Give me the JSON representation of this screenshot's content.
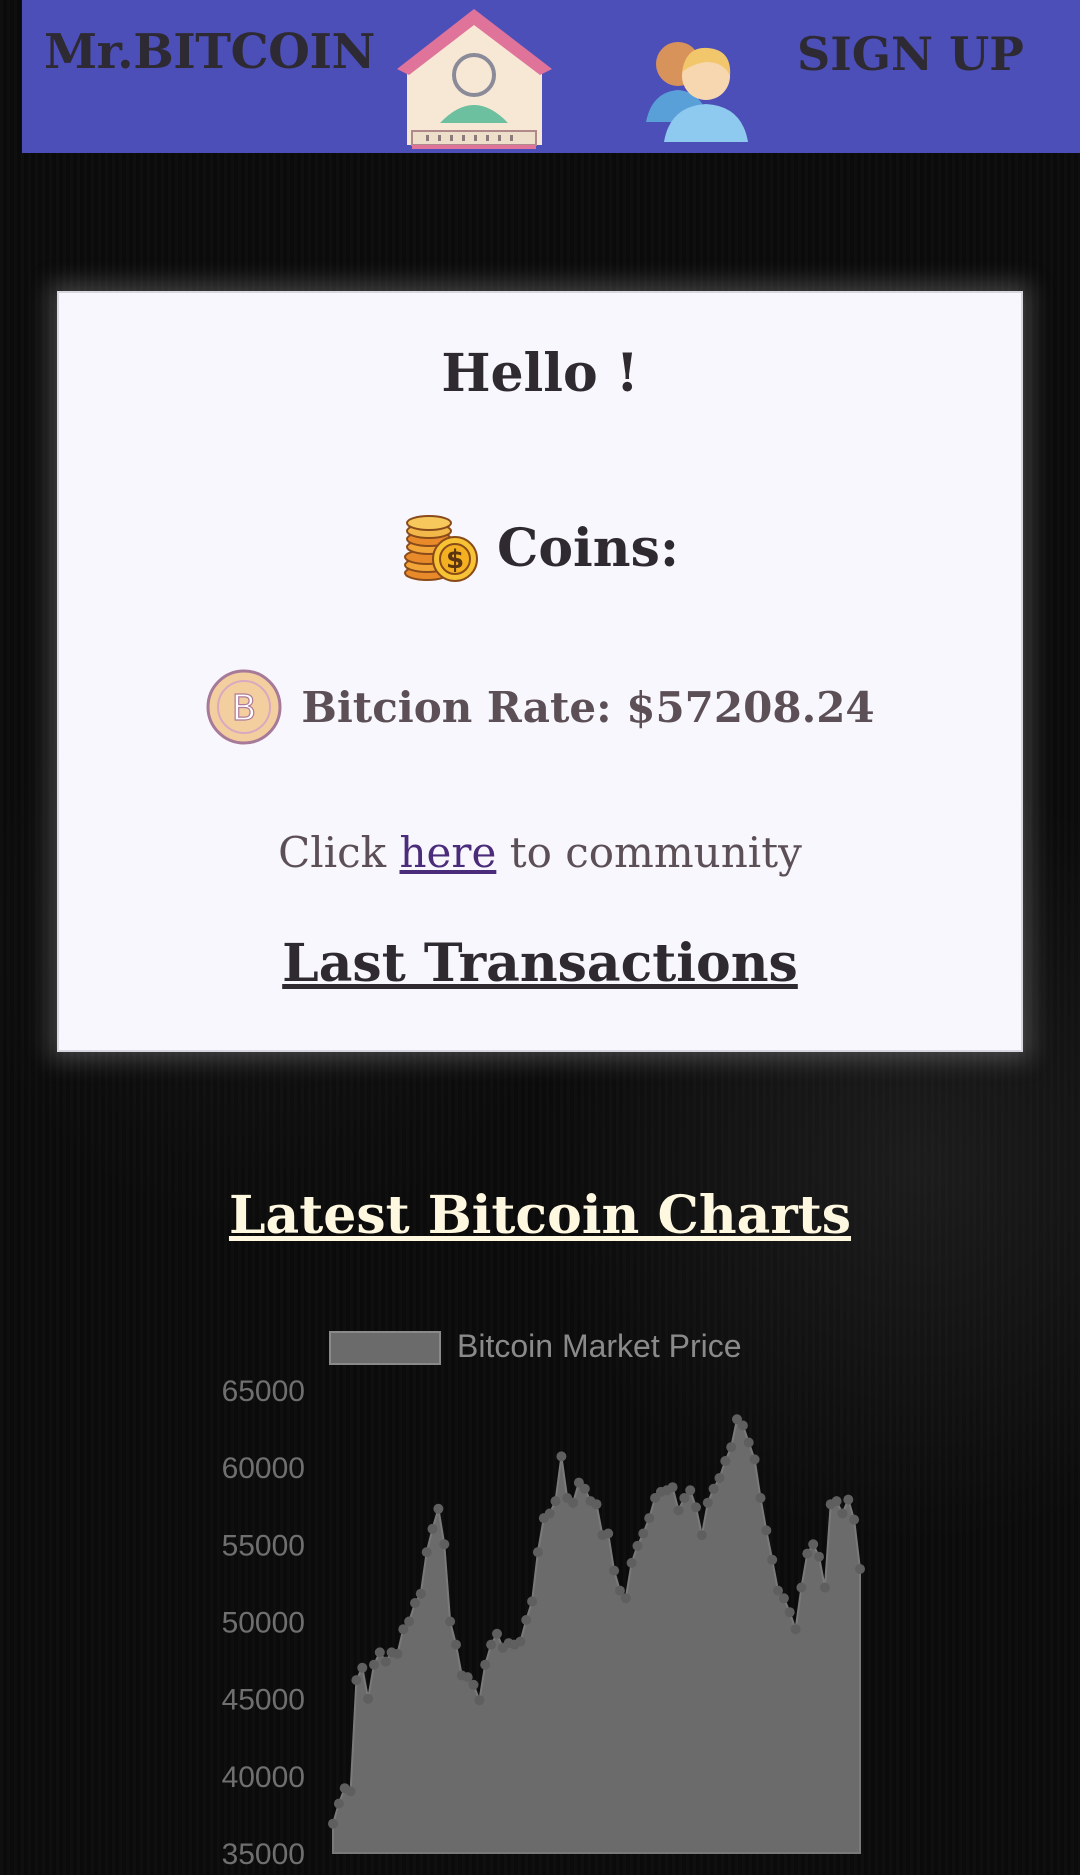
{
  "navbar": {
    "brand": "Mr.BITCOIN",
    "home_icon": "home-user-icon",
    "contacts_icon": "users-icon",
    "signup_label": "SIGN UP",
    "background": "#4d4fb8"
  },
  "card": {
    "greeting": "Hello !",
    "coins_label": "Coins:",
    "coins_icon": "coin-stack-icon",
    "rate_icon": "bitcoin-icon",
    "rate_label": "Bitcion Rate: $57208.24",
    "community": {
      "prefix": "Click",
      "link_text": "here",
      "suffix": "to community"
    },
    "last_transactions_title": "Last Transactions"
  },
  "charts_section": {
    "title": "Latest Bitcoin Charts"
  },
  "chart_data": {
    "type": "area",
    "title": "",
    "xlabel": "",
    "ylabel": "",
    "ylim": [
      35000,
      65000
    ],
    "yticks": [
      "65000",
      "60000",
      "55000",
      "50000",
      "45000",
      "40000",
      "35000"
    ],
    "legend": "top",
    "grid": false,
    "series": [
      {
        "name": "Bitcoin Market Price",
        "color": "#6b6b6b",
        "values": [
          36900,
          38200,
          39200,
          39000,
          46200,
          47000,
          45000,
          47200,
          48000,
          47400,
          48000,
          47900,
          49500,
          50000,
          51200,
          51800,
          54500,
          56000,
          57300,
          55000,
          50000,
          48500,
          46500,
          46400,
          45900,
          44900,
          47200,
          48500,
          49200,
          48300,
          48600,
          48500,
          48700,
          50100,
          51300,
          54500,
          56700,
          57000,
          57800,
          60700,
          58000,
          57700,
          59000,
          58600,
          57800,
          57600,
          55600,
          55700,
          53300,
          52000,
          51500,
          53800,
          54900,
          55700,
          56700,
          58000,
          58400,
          58500,
          58700,
          57200,
          58000,
          58500,
          57400,
          55600,
          57700,
          58600,
          59300,
          60400,
          61300,
          63100,
          62700,
          61600,
          60500,
          58000,
          55900,
          54000,
          52000,
          51500,
          50600,
          49500,
          52200,
          54400,
          55000,
          54200,
          52200,
          57600,
          57800,
          57000,
          57900,
          56600,
          53400
        ]
      }
    ]
  }
}
